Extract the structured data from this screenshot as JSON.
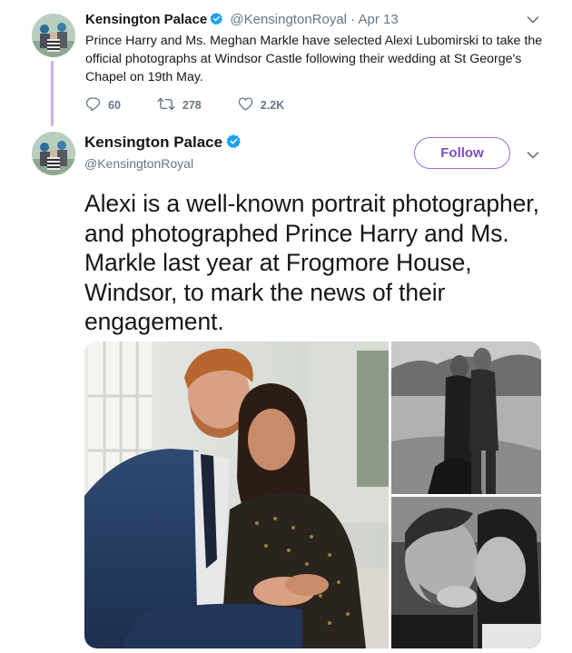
{
  "tweet1": {
    "name": "Kensington Palace",
    "handle": "@KensingtonRoyal",
    "dot": "·",
    "date": "Apr 13",
    "text": "Prince Harry and Ms. Meghan Markle have selected Alexi Lubomirski to take the official photographs at Windsor Castle following their wedding at St George's Chapel on 19th May.",
    "replies": "60",
    "retweets": "278",
    "likes": "2.2K"
  },
  "tweet2": {
    "name": "Kensington Palace",
    "handle": "@KensingtonRoyal",
    "follow_label": "Follow",
    "text": "Alexi is a well-known portrait photographer, and photographed Prince Harry and Ms. Markle last year at Frogmore House, Windsor, to mark the news of their engagement."
  },
  "colors": {
    "verified": "#1da1f2",
    "follow_border": "#9d6bd1",
    "thread_line": "#c7b3e2",
    "secondary_text": "#657786"
  },
  "icons": [
    "verified-badge-icon",
    "chevron-down-icon",
    "reply-icon",
    "retweet-icon",
    "like-icon"
  ]
}
